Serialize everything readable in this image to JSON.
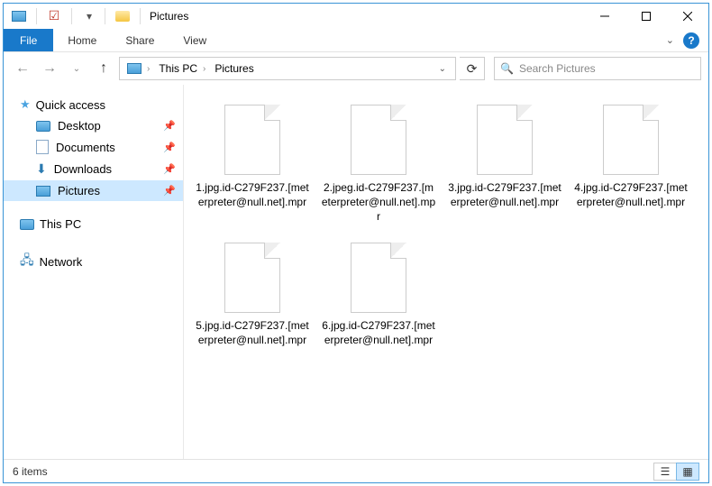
{
  "titlebar": {
    "title": "Pictures"
  },
  "ribbon": {
    "file": "File",
    "tabs": [
      "Home",
      "Share",
      "View"
    ]
  },
  "addressbar": {
    "crumbs": [
      "This PC",
      "Pictures"
    ]
  },
  "search": {
    "placeholder": "Search Pictures"
  },
  "sidebar": {
    "quickaccess": {
      "label": "Quick access"
    },
    "items": [
      {
        "label": "Desktop",
        "icon": "desktop",
        "pinned": true
      },
      {
        "label": "Documents",
        "icon": "documents",
        "pinned": true
      },
      {
        "label": "Downloads",
        "icon": "downloads",
        "pinned": true
      },
      {
        "label": "Pictures",
        "icon": "pictures",
        "pinned": true,
        "selected": true
      }
    ],
    "thispc": {
      "label": "This PC"
    },
    "network": {
      "label": "Network"
    }
  },
  "files": [
    {
      "name": "1.jpg.id-C279F237.[meterpreter@null.net].mpr"
    },
    {
      "name": "2.jpeg.id-C279F237.[meterpreter@null.net].mpr"
    },
    {
      "name": "3.jpg.id-C279F237.[meterpreter@null.net].mpr"
    },
    {
      "name": "4.jpg.id-C279F237.[meterpreter@null.net].mpr"
    },
    {
      "name": "5.jpg.id-C279F237.[meterpreter@null.net].mpr"
    },
    {
      "name": "6.jpg.id-C279F237.[meterpreter@null.net].mpr"
    }
  ],
  "status": {
    "text": "6 items"
  }
}
